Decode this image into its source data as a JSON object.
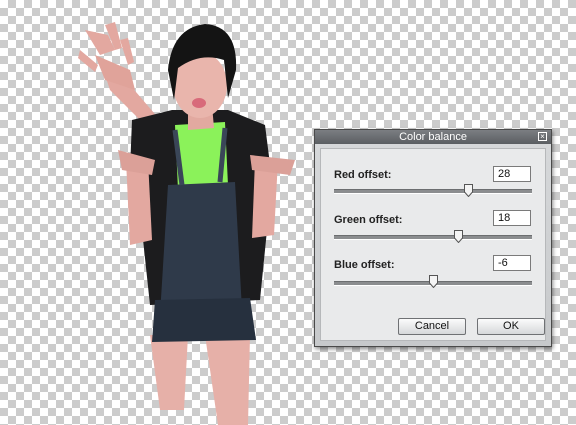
{
  "dialog": {
    "title": "Color balance",
    "close_icon": "close-icon",
    "sliders": [
      {
        "label": "Red offset:",
        "value": "28"
      },
      {
        "label": "Green offset:",
        "value": "18"
      },
      {
        "label": "Blue offset:",
        "value": "-6"
      }
    ],
    "cancel_label": "Cancel",
    "ok_label": "OK"
  }
}
